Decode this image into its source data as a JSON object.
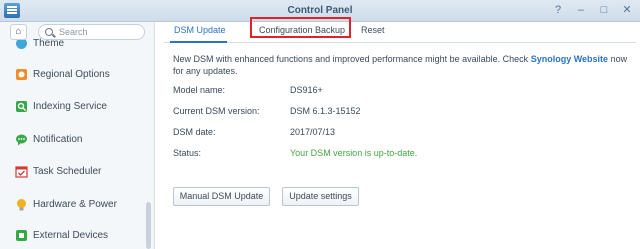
{
  "window": {
    "title": "Control Panel"
  },
  "sidebar": {
    "home_icon": "home-icon",
    "search_placeholder": "Search",
    "items": [
      {
        "label": "Theme",
        "icon": "theme-icon"
      },
      {
        "label": "Regional Options",
        "icon": "regional-options-icon"
      },
      {
        "label": "Indexing Service",
        "icon": "indexing-service-icon"
      },
      {
        "label": "Notification",
        "icon": "notification-icon"
      },
      {
        "label": "Task Scheduler",
        "icon": "task-scheduler-icon"
      },
      {
        "label": "Hardware & Power",
        "icon": "hardware-power-icon"
      },
      {
        "label": "External Devices",
        "icon": "external-devices-icon"
      }
    ]
  },
  "tabs": [
    {
      "label": "DSM Update"
    },
    {
      "label": "Configuration Backup"
    },
    {
      "label": "Reset"
    }
  ],
  "description": {
    "text": "New DSM with enhanced functions and improved performance might be available. Check",
    "link": "Synology Website",
    "suffix": "now for any updates."
  },
  "info": [
    {
      "label": "Model name:",
      "value": "DS916+"
    },
    {
      "label": "Current DSM version:",
      "value": "DSM 6.1.3-15152"
    },
    {
      "label": "DSM date:",
      "value": "2017/07/13"
    },
    {
      "label": "Status:",
      "value": "Your DSM version is up-to-date."
    }
  ],
  "buttons": {
    "manual_update": "Manual DSM Update",
    "update_settings": "Update settings"
  },
  "colors": {
    "accent": "#2b74c4",
    "status_ok": "#3fa63f",
    "highlight": "#e0232a"
  }
}
